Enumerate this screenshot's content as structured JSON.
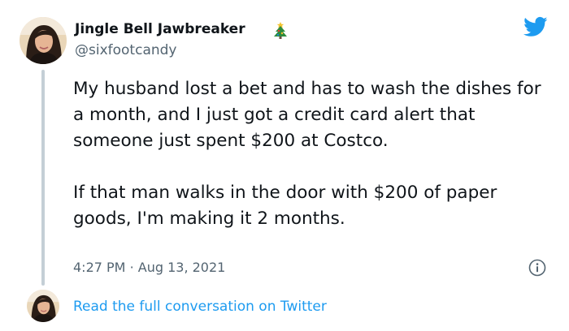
{
  "tweet": {
    "author": {
      "display_name": "Jingle Bell Jawbreaker",
      "name_emoji_icon": "christmas-tree-icon",
      "handle": "@sixfootcandy",
      "avatar_icon": "profile-photo"
    },
    "body": {
      "paragraph_1": "My husband lost a bet and has to wash the dishes for a month, and I just got a credit card alert that someone just spent $200 at Costco.",
      "paragraph_2": "If that man walks in the door with $200 of paper goods, I'm making it 2 months."
    },
    "time": "4:27 PM",
    "separator": "·",
    "date": "Aug 13, 2021",
    "info_icon": "info-icon",
    "brand_icon": "twitter-bird-icon"
  },
  "footer": {
    "link_label": "Read the full conversation on Twitter"
  },
  "colors": {
    "brand_blue": "#1d9bf0",
    "text_primary": "#0f1419",
    "text_secondary": "#536471",
    "thread_line": "#c4cfd6"
  }
}
